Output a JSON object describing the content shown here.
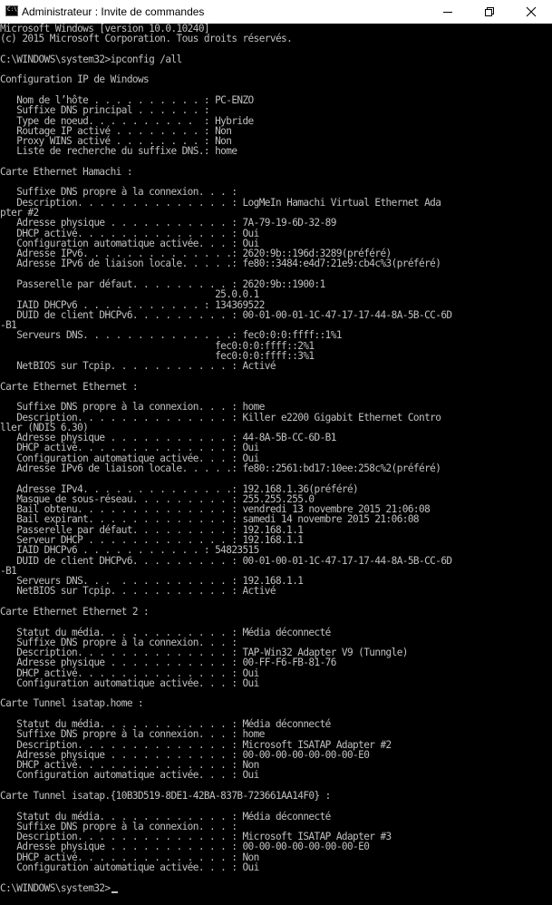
{
  "window": {
    "title": "Administrateur : Invite de commandes",
    "icon": "cmd-icon",
    "buttons": [
      "minimize-icon",
      "maximize-icon",
      "close-icon"
    ]
  },
  "console": {
    "background": "#000000",
    "foreground": "#c0c0c0",
    "lines": [
      "Microsoft Windows [version 10.0.10240]",
      "(c) 2015 Microsoft Corporation. Tous droits réservés.",
      "",
      "C:\\WINDOWS\\system32>ipconfig /all",
      "",
      "Configuration IP de Windows",
      "",
      "   Nom de l’hôte . . . . . . . . . . : PC-ENZO",
      "   Suffixe DNS principal . . . . . . :",
      "   Type de noeud. . . . . . . . . .  : Hybride",
      "   Routage IP activé . . . . . . . . : Non",
      "   Proxy WINS activé . . . . . . . . : Non",
      "   Liste de recherche du suffixe DNS.: home",
      "",
      "Carte Ethernet Hamachi :",
      "",
      "   Suffixe DNS propre à la connexion. . . :",
      "   Description. . . . . . . . . . . . . . : LogMeIn Hamachi Virtual Ethernet Ada",
      "pter #2",
      "   Adresse physique . . . . . . . . . . . : 7A-79-19-6D-32-89",
      "   DHCP activé. . . . . . . . . . . . . . : Oui",
      "   Configuration automatique activée. . . : Oui",
      "   Adresse IPv6. . . . . . . . . . . . . .: 2620:9b::196d:3289(préféré)",
      "   Adresse IPv6 de liaison locale. . . . .: fe80::3484:e4d7:21e9:cb4c%3(préféré)",
      "",
      "   Passerelle par défaut. . . . . . . . . : 2620:9b::1900:1",
      "                                       25.0.0.1",
      "   IAID DHCPv6 . . . . . . . . . . . : 134369522",
      "   DUID de client DHCPv6. . . . . . . . . : 00-01-00-01-1C-47-17-17-44-8A-5B-CC-6D",
      "-B1",
      "   Serveurs DNS. . . . . . . . . . . . . .: fec0:0:0:ffff::1%1",
      "                                       fec0:0:0:ffff::2%1",
      "                                       fec0:0:0:ffff::3%1",
      "   NetBIOS sur Tcpip. . . . . . . . . . . : Activé",
      "",
      "Carte Ethernet Ethernet :",
      "",
      "   Suffixe DNS propre à la connexion. . . : home",
      "   Description. . . . . . . . . . . . . . : Killer e2200 Gigabit Ethernet Contro",
      "ller (NDIS 6.30)",
      "   Adresse physique . . . . . . . . . . . : 44-8A-5B-CC-6D-B1",
      "   DHCP activé. . . . . . . . . . . . . . : Oui",
      "   Configuration automatique activée. . . : Oui",
      "   Adresse IPv6 de liaison locale. . . . .: fe80::2561:bd17:10ee:258c%2(préféré)",
      "",
      "   Adresse IPv4. . . . . . . . . . . . . .: 192.168.1.36(préféré)",
      "   Masque de sous-réseau. . . . . . . . . : 255.255.255.0",
      "   Bail obtenu. . . . . . . . . . . . . . : vendredi 13 novembre 2015 21:06:08",
      "   Bail expirant. . . . . . . . . . . . . : samedi 14 novembre 2015 21:06:08",
      "   Passerelle par défaut. . . . . . . . . : 192.168.1.1",
      "   Serveur DHCP . . . . . . . . . . . . . : 192.168.1.1",
      "   IAID DHCPv6 . . . . . . . . . . . : 54823515",
      "   DUID de client DHCPv6. . . . . . . . . : 00-01-00-01-1C-47-17-17-44-8A-5B-CC-6D",
      "-B1",
      "   Serveurs DNS. . .  . . . . . . . . . . : 192.168.1.1",
      "   NetBIOS sur Tcpip. . . . . . . . . . . : Activé",
      "",
      "Carte Ethernet Ethernet 2 :",
      "",
      "   Statut du média. . . . . . . . . . . . : Média déconnecté",
      "   Suffixe DNS propre à la connexion. . . :",
      "   Description. . . . . . . . . . . . . . : TAP-Win32 Adapter V9 (Tunngle)",
      "   Adresse physique . . . . . . . . . . . : 00-FF-F6-FB-81-76",
      "   DHCP activé. . . . . . . . . . . . . . : Oui",
      "   Configuration automatique activée. . . : Oui",
      "",
      "Carte Tunnel isatap.home :",
      "",
      "   Statut du média. . . . . . . . . . . . : Média déconnecté",
      "   Suffixe DNS propre à la connexion. . . : home",
      "   Description. . . . . . . . . . . . . . : Microsoft ISATAP Adapter #2",
      "   Adresse physique . . . . . . . . . . . : 00-00-00-00-00-00-00-E0",
      "   DHCP activé. . . . . . . . . . . . . . : Non",
      "   Configuration automatique activée. . . : Oui",
      "",
      "Carte Tunnel isatap.{10B3D519-8DE1-42BA-837B-723661AA14F0} :",
      "",
      "   Statut du média. . . . . . . . . . . . : Média déconnecté",
      "   Suffixe DNS propre à la connexion. . . :",
      "   Description. . . . . . . . . . . . . . : Microsoft ISATAP Adapter #3",
      "   Adresse physique . . . . . . . . . . . : 00-00-00-00-00-00-00-E0",
      "   DHCP activé. . . . . . . . . . . . . . : Non",
      "   Configuration automatique activée. . . : Oui",
      "",
      "C:\\WINDOWS\\system32>"
    ]
  }
}
